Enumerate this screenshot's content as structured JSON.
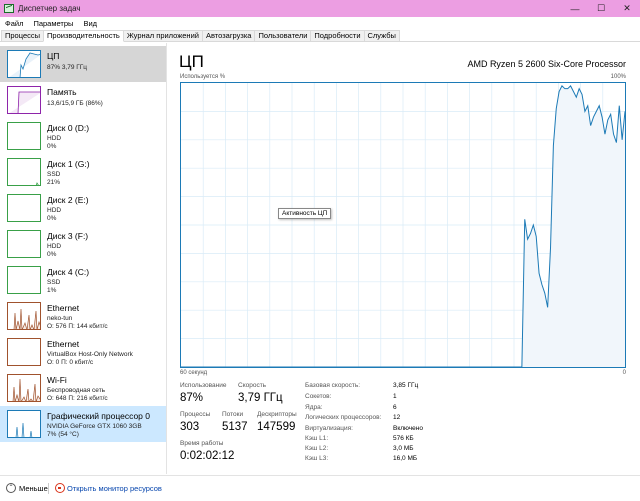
{
  "window": {
    "title": "Диспетчер задач",
    "min": "—",
    "max": "☐",
    "close": "✕"
  },
  "menu": [
    "Файл",
    "Параметры",
    "Вид"
  ],
  "tabs": [
    {
      "label": "Процессы",
      "active": false
    },
    {
      "label": "Производительность",
      "active": true
    },
    {
      "label": "Журнал приложений",
      "active": false
    },
    {
      "label": "Автозагрузка",
      "active": false
    },
    {
      "label": "Пользователи",
      "active": false
    },
    {
      "label": "Подробности",
      "active": false
    },
    {
      "label": "Службы",
      "active": false
    }
  ],
  "sidebar": {
    "items": [
      {
        "name": "ЦП",
        "line1": "87% 3,79 ГГц",
        "line2": ""
      },
      {
        "name": "Память",
        "line1": "13,6/15,9 ГБ (86%)",
        "line2": ""
      },
      {
        "name": "Диск 0 (D:)",
        "line1": "HDD",
        "line2": "0%"
      },
      {
        "name": "Диск 1 (G:)",
        "line1": "SSD",
        "line2": "21%"
      },
      {
        "name": "Диск 2 (E:)",
        "line1": "HDD",
        "line2": "0%"
      },
      {
        "name": "Диск 3 (F:)",
        "line1": "HDD",
        "line2": "0%"
      },
      {
        "name": "Диск 4 (C:)",
        "line1": "SSD",
        "line2": "1%"
      },
      {
        "name": "Ethernet",
        "line1": "neko-tun",
        "line2": "О: 576 П: 144 кбит/с"
      },
      {
        "name": "Ethernet",
        "line1": "VirtualBox Host-Only Network",
        "line2": "О: 0 П: 0 кбит/с"
      },
      {
        "name": "Wi-Fi",
        "line1": "Беспроводная сеть",
        "line2": "О: 648 П: 216 кбит/с"
      },
      {
        "name": "Графический процессор 0",
        "line1": "NVIDIA GeForce GTX 1060 3GB",
        "line2": "7% (54 °C)"
      }
    ]
  },
  "main": {
    "title": "ЦП",
    "processor": "AMD Ryzen 5 2600 Six-Core Processor",
    "util_label": "Используется %",
    "max_label": "100%",
    "time_label": "60 секунд",
    "min_label": "0",
    "tooltip": "Активность ЦП",
    "stats": {
      "util_label": "Использование",
      "util_value": "87%",
      "speed_label": "Скорость",
      "speed_value": "3,79 ГГц",
      "proc_label": "Процессы",
      "proc_value": "303",
      "thr_label": "Потоки",
      "thr_value": "5137",
      "handles_label": "Дескрипторы",
      "handles_value": "147599",
      "uptime_label": "Время работы",
      "uptime_value": "0:02:02:12"
    },
    "details": [
      {
        "label": "Базовая скорость:",
        "value": "3,85 ГГц"
      },
      {
        "label": "Сокетов:",
        "value": "1"
      },
      {
        "label": "Ядра:",
        "value": "6"
      },
      {
        "label": "Логических процессоров:",
        "value": "12"
      },
      {
        "label": "Виртуализация:",
        "value": "Включено"
      },
      {
        "label": "Кэш L1:",
        "value": "576 КБ"
      },
      {
        "label": "Кэш L2:",
        "value": "3,0 МБ"
      },
      {
        "label": "Кэш L3:",
        "value": "16,0 МБ"
      }
    ]
  },
  "cpu_history": [
    0,
    0,
    0,
    0,
    0,
    0,
    0,
    0,
    0,
    0,
    0,
    0,
    0,
    0,
    0,
    0,
    0,
    0,
    0,
    0,
    0,
    0,
    0,
    0,
    0,
    0,
    0,
    0,
    0,
    0,
    0,
    0,
    0,
    0,
    0,
    0,
    0,
    0,
    0,
    0,
    0,
    0,
    0,
    0,
    0,
    0,
    0,
    0,
    0,
    0,
    0,
    0,
    0,
    0,
    0,
    0,
    0,
    0,
    0,
    0,
    0,
    0,
    0,
    0,
    0,
    0,
    0,
    0,
    0,
    0,
    0,
    0,
    0,
    0,
    0,
    0,
    0,
    0,
    0,
    0,
    0,
    0,
    0,
    0,
    0,
    0,
    0,
    0,
    0,
    0,
    0,
    0,
    0,
    0,
    0,
    0,
    0,
    0,
    0,
    0,
    0,
    0,
    0,
    0,
    0,
    0,
    0,
    0,
    0,
    0,
    0,
    0,
    0,
    0,
    0,
    0,
    0,
    0,
    0,
    0,
    52,
    45,
    47,
    50,
    46,
    33,
    29,
    26,
    21,
    42,
    78,
    91,
    97,
    99,
    98,
    98,
    99,
    97,
    95,
    98,
    96,
    90,
    92,
    85,
    88,
    90,
    92,
    88,
    82,
    87,
    89,
    82,
    79,
    92,
    80,
    90
  ],
  "bottom": {
    "less": "Меньше",
    "monitor": "Открыть монитор ресурсов"
  },
  "colors": {
    "cpu": "#1c7ab6",
    "cpu_fill": "#f1f6fb",
    "memory": "#8e24aa",
    "disk": "#39a048",
    "net": "#a0522d",
    "grid": "#d9ebf7"
  }
}
